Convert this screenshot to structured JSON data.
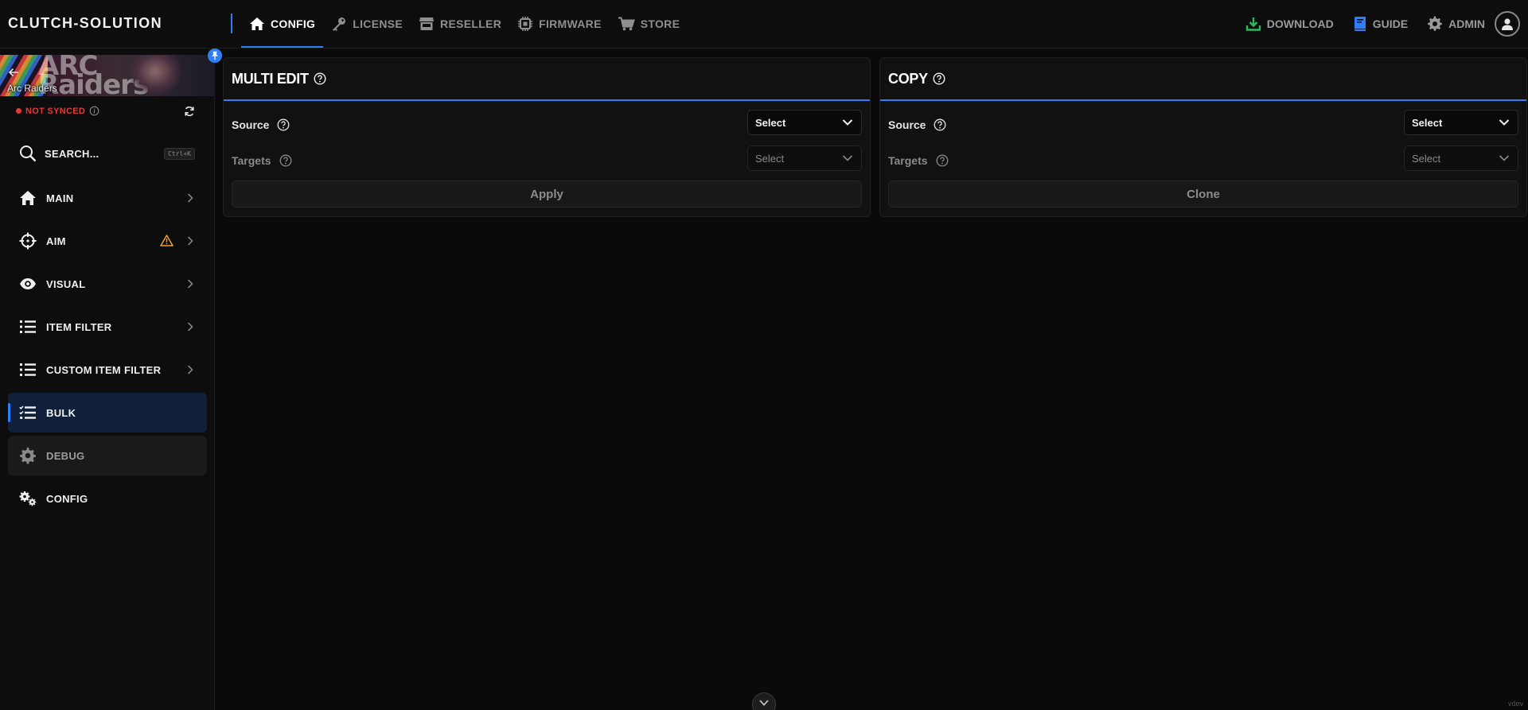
{
  "brand": "CLUTCH-SOLUTION",
  "nav": [
    {
      "label": "CONFIG",
      "icon": "home-icon",
      "active": true
    },
    {
      "label": "LICENSE",
      "icon": "key-icon"
    },
    {
      "label": "RESELLER",
      "icon": "store-icon"
    },
    {
      "label": "FIRMWARE",
      "icon": "chip-icon"
    },
    {
      "label": "STORE",
      "icon": "cart-icon"
    }
  ],
  "nav_right": {
    "download": "DOWNLOAD",
    "guide": "GUIDE",
    "admin": "ADMIN"
  },
  "sidebar": {
    "game": "Arc Raiders",
    "banner_art": "ARC Raiders",
    "sync_status": "NOT SYNCED",
    "search_label": "SEARCH...",
    "search_shortcut": "Ctrl+K",
    "items": [
      {
        "label": "MAIN",
        "icon": "home-icon"
      },
      {
        "label": "AIM",
        "icon": "crosshair-icon",
        "warning": true
      },
      {
        "label": "VISUAL",
        "icon": "eye-icon"
      },
      {
        "label": "ITEM FILTER",
        "icon": "list-icon"
      },
      {
        "label": "CUSTOM ITEM FILTER",
        "icon": "list-icon"
      },
      {
        "label": "BULK",
        "icon": "checklist-icon",
        "active": true
      },
      {
        "label": "DEBUG",
        "icon": "gear-icon"
      },
      {
        "label": "CONFIG",
        "icon": "gears-icon"
      }
    ]
  },
  "multi_edit": {
    "title": "MULTI EDIT",
    "source_label": "Source",
    "source_value": "Select",
    "targets_label": "Targets",
    "targets_value": "Select",
    "button": "Apply"
  },
  "copy": {
    "title": "COPY",
    "source_label": "Source",
    "source_value": "Select",
    "targets_label": "Targets",
    "targets_value": "Select",
    "button": "Clone"
  },
  "colors": {
    "accent": "#2d7ff9",
    "error": "#e53935",
    "warning": "#f0a030",
    "download": "#2eb85c"
  },
  "version": "vdev"
}
